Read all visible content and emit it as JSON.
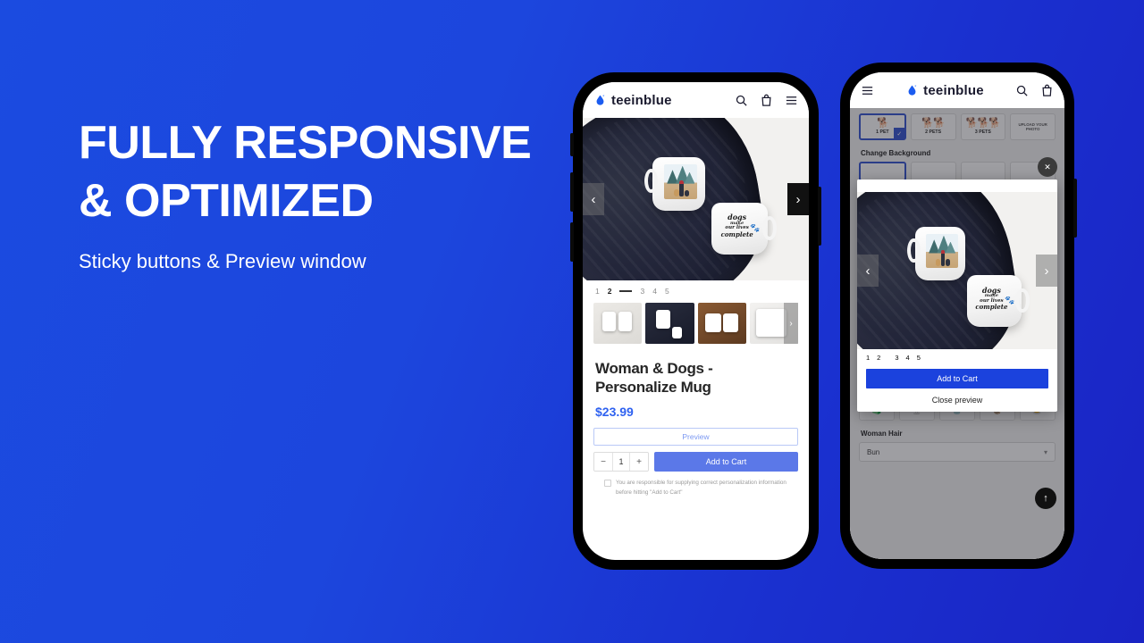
{
  "marketing": {
    "headline_line1": "FULLY RESPONSIVE",
    "headline_line2": "& OPTIMIZED",
    "subhead": "Sticky buttons & Preview window",
    "bg_from": "#1B4BE0",
    "bg_to": "#1A24C4"
  },
  "brand": {
    "name": "teeinblue",
    "logo_icon": "water-droplet-icon",
    "color": "#1b5cf0"
  },
  "phone1": {
    "header": {
      "search_icon": "search-icon",
      "bag_icon": "shopping-bag-icon",
      "menu_icon": "hamburger-menu-icon"
    },
    "gallery": {
      "prev_icon": "chevron-left-icon",
      "next_icon": "chevron-right-icon",
      "mug_script_line1": "dogs",
      "mug_script_line2": "make",
      "mug_script_line3": "our lives",
      "mug_script_line4": "complete",
      "paw_icon": "paw-print-icon"
    },
    "pager": {
      "pages": [
        "1",
        "2",
        "3",
        "4",
        "5"
      ],
      "active": "2"
    },
    "thumbnails": [
      "thumb-mugs-hands",
      "thumb-mug-navy-blanket",
      "thumb-mugs-wood",
      "thumb-mug-closeup"
    ],
    "thumb_next_icon": "chevron-right-icon",
    "product": {
      "title": "Woman & Dogs - Personalize Mug",
      "price": "$23.99"
    },
    "actions": {
      "preview_label": "Preview",
      "minus": "−",
      "quantity": "1",
      "plus": "+",
      "add_to_cart_label": "Add to Cart",
      "accent_preview": "#7b98f2",
      "accent_cart": "#5b78e8"
    },
    "disclaimer": "You are responsible for supplying correct personalization information before hitting \"Add to Cart\""
  },
  "phone2": {
    "header": {
      "menu_icon": "hamburger-menu-icon",
      "search_icon": "search-icon",
      "bag_icon": "shopping-bag-icon"
    },
    "pet_options": [
      {
        "label": "1 PET",
        "dogs": "🐕",
        "selected": true,
        "check_icon": "check-icon"
      },
      {
        "label": "2 PETS",
        "dogs": "🐕🐕",
        "selected": false
      },
      {
        "label": "3 PETS",
        "dogs": "🐕🐕🐕",
        "selected": false
      },
      {
        "label": "UPLOAD YOUR PHOTO",
        "upload": true,
        "selected": false
      }
    ],
    "change_background_label": "Change Background",
    "close_icon": "close-icon",
    "scroll_top_icon": "arrow-up-icon",
    "preview": {
      "prev_icon": "chevron-left-icon",
      "next_icon": "chevron-right-icon",
      "pages": [
        "1",
        "2",
        "3",
        "4",
        "5"
      ],
      "active": "2",
      "add_to_cart_label": "Add to Cart",
      "close_preview_label": "Close preview",
      "cart_color": "#1b42dd"
    },
    "drinks": [
      "🧃",
      "🍸",
      "🥤",
      "🧋",
      "🍺"
    ],
    "hair_label": "Woman Hair",
    "hair_value": "Bun",
    "hair_chevron_icon": "chevron-down-icon"
  }
}
